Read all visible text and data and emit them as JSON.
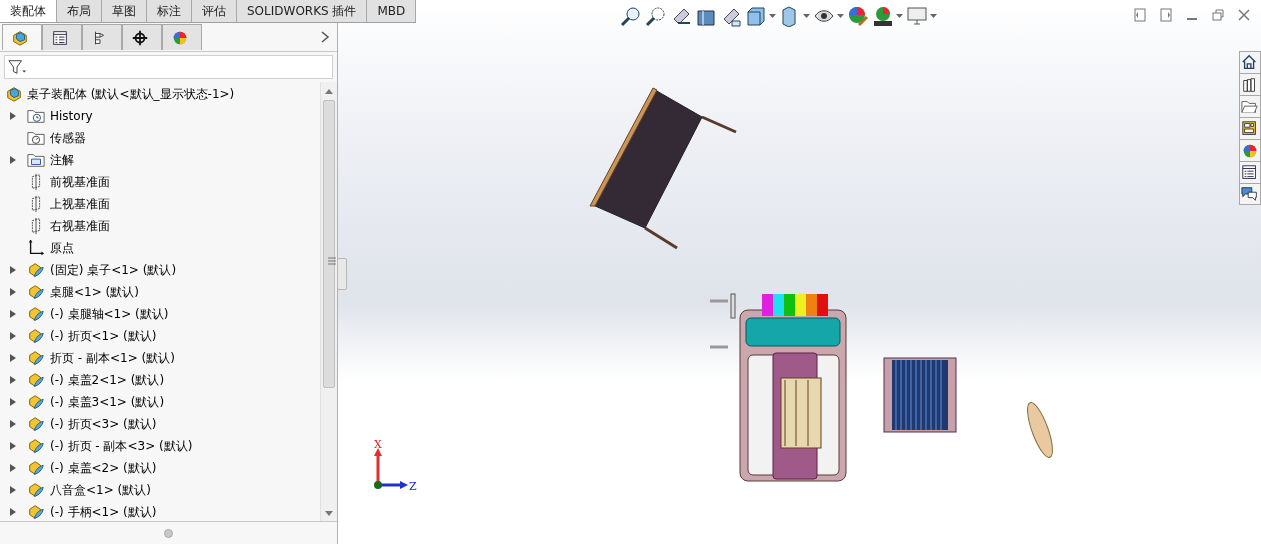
{
  "command_tabs": [
    {
      "label": "装配体",
      "selected": true
    },
    {
      "label": "布局",
      "selected": false
    },
    {
      "label": "草图",
      "selected": false
    },
    {
      "label": "标注",
      "selected": false
    },
    {
      "label": "评估",
      "selected": false
    },
    {
      "label": "SOLIDWORKS 插件",
      "selected": false
    },
    {
      "label": "MBD",
      "selected": false
    }
  ],
  "panel_tabs": [
    {
      "kind": "feature",
      "selected": true
    },
    {
      "kind": "property",
      "selected": false
    },
    {
      "kind": "config",
      "selected": false
    },
    {
      "kind": "dimxpert",
      "selected": false
    },
    {
      "kind": "display",
      "selected": false
    }
  ],
  "tree": {
    "root": {
      "label": "桌子装配体  (默认<默认_显示状态-1>)"
    },
    "items": [
      {
        "kind": "history",
        "label": "History",
        "expandable": true
      },
      {
        "kind": "sensor",
        "label": "传感器",
        "expandable": false
      },
      {
        "kind": "annotation",
        "label": "注解",
        "expandable": true
      },
      {
        "kind": "plane",
        "label": "前视基准面",
        "expandable": false
      },
      {
        "kind": "plane",
        "label": "上视基准面",
        "expandable": false
      },
      {
        "kind": "plane",
        "label": "右视基准面",
        "expandable": false
      },
      {
        "kind": "origin",
        "label": "原点",
        "expandable": false
      },
      {
        "kind": "part",
        "label": "(固定) 桌子<1> (默认)",
        "expandable": true
      },
      {
        "kind": "part",
        "label": "桌腿<1> (默认)",
        "expandable": true
      },
      {
        "kind": "part",
        "label": "(-) 桌腿轴<1> (默认)",
        "expandable": true
      },
      {
        "kind": "part",
        "label": "(-) 折页<1> (默认)",
        "expandable": true
      },
      {
        "kind": "part",
        "label": "折页 - 副本<1> (默认)",
        "expandable": true
      },
      {
        "kind": "part",
        "label": "(-) 桌盖2<1> (默认)",
        "expandable": true
      },
      {
        "kind": "part",
        "label": "(-) 桌盖3<1> (默认)",
        "expandable": true
      },
      {
        "kind": "part",
        "label": "(-) 折页<3> (默认)",
        "expandable": true
      },
      {
        "kind": "part",
        "label": "(-) 折页 - 副本<3> (默认)",
        "expandable": true
      },
      {
        "kind": "part",
        "label": "(-) 桌盖<2> (默认)",
        "expandable": true
      },
      {
        "kind": "part",
        "label": "八音盒<1> (默认)",
        "expandable": true
      },
      {
        "kind": "part",
        "label": "(-) 手柄<1> (默认)",
        "expandable": true
      }
    ]
  },
  "view_toolbar": [
    {
      "kind": "zoom-fit",
      "dropdown": false
    },
    {
      "kind": "zoom-area",
      "dropdown": false
    },
    {
      "kind": "previous",
      "dropdown": false
    },
    {
      "kind": "section",
      "dropdown": false
    },
    {
      "kind": "annotation",
      "dropdown": false
    },
    {
      "kind": "orientation",
      "dropdown": true
    },
    {
      "kind": "display-style",
      "dropdown": true
    },
    {
      "kind": "hide-show",
      "dropdown": true
    },
    {
      "kind": "appearance",
      "dropdown": false
    },
    {
      "kind": "scene",
      "dropdown": true
    },
    {
      "kind": "monitor",
      "dropdown": true
    }
  ],
  "task_pane": [
    {
      "kind": "home"
    },
    {
      "kind": "library"
    },
    {
      "kind": "folder"
    },
    {
      "kind": "palette"
    },
    {
      "kind": "appearance"
    },
    {
      "kind": "properties"
    },
    {
      "kind": "forum"
    }
  ],
  "triad": {
    "axes": [
      {
        "kind": "x",
        "label": "X"
      },
      {
        "kind": "z",
        "label": "Z"
      }
    ]
  }
}
